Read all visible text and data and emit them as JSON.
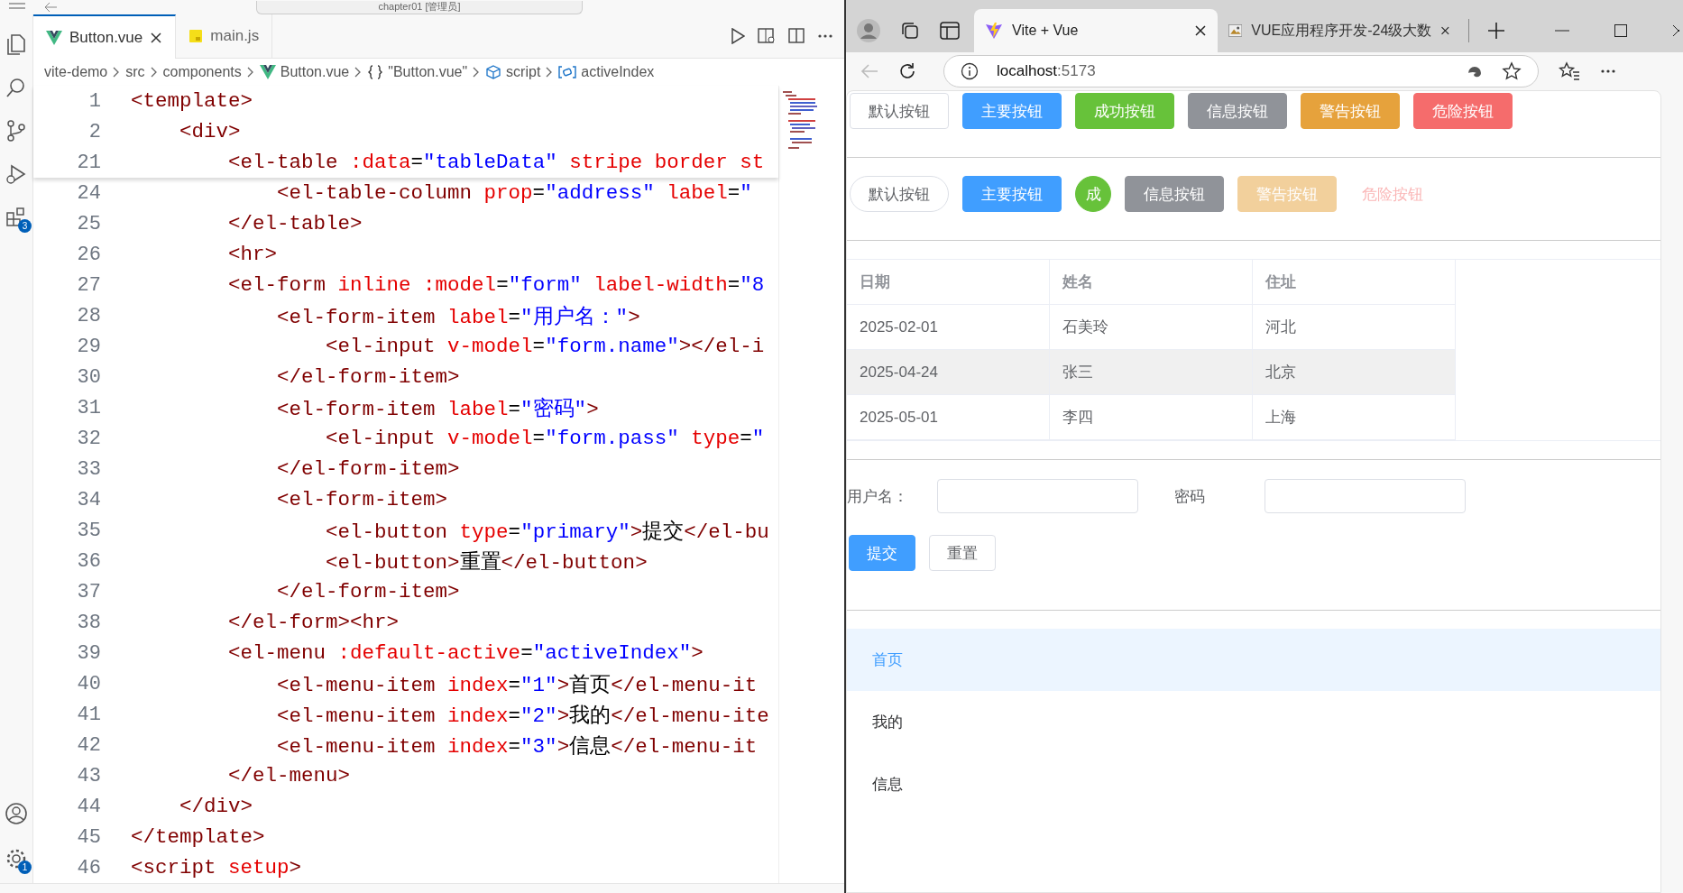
{
  "editor": {
    "title_bar": {
      "search": "chapter01 [管理员]"
    },
    "activity_bar": {
      "extensions_badge": "3",
      "settings_badge": "1"
    },
    "tabs": [
      {
        "label": "Button.vue",
        "kind": "vue",
        "selected": true
      },
      {
        "label": "main.js",
        "kind": "js",
        "selected": false
      }
    ],
    "breadcrumb": [
      {
        "label": "vite-demo",
        "kind": "folder"
      },
      {
        "label": "src",
        "kind": "folder"
      },
      {
        "label": "components",
        "kind": "folder"
      },
      {
        "label": "Button.vue",
        "kind": "vue"
      },
      {
        "label": "\"Button.vue\"",
        "kind": "braces"
      },
      {
        "label": "script",
        "kind": "cube"
      },
      {
        "label": "activeIndex",
        "kind": "field"
      }
    ],
    "sticky_lines": [
      {
        "number": "1",
        "code": "<template>"
      },
      {
        "number": "2",
        "code": "    <div>"
      },
      {
        "number": "21",
        "code": "        <el-table :data=\"tableData\" stripe border st"
      }
    ],
    "lines": [
      {
        "number": "24",
        "code": "            <el-table-column prop=\"address\" label=\""
      },
      {
        "number": "25",
        "code": "        </el-table>"
      },
      {
        "number": "26",
        "code": "        <hr>"
      },
      {
        "number": "27",
        "code": "        <el-form inline :model=\"form\" label-width=\"8"
      },
      {
        "number": "28",
        "code": "            <el-form-item label=\"用户名：\">"
      },
      {
        "number": "29",
        "code": "                <el-input v-model=\"form.name\"></el-i"
      },
      {
        "number": "30",
        "code": "            </el-form-item>"
      },
      {
        "number": "31",
        "code": "            <el-form-item label=\"密码\">"
      },
      {
        "number": "32",
        "code": "                <el-input v-model=\"form.pass\" type=\""
      },
      {
        "number": "33",
        "code": "            </el-form-item>"
      },
      {
        "number": "34",
        "code": "            <el-form-item>"
      },
      {
        "number": "35",
        "code": "                <el-button type=\"primary\">提交</el-bu"
      },
      {
        "number": "36",
        "code": "                <el-button>重置</el-button>"
      },
      {
        "number": "37",
        "code": "            </el-form-item>"
      },
      {
        "number": "38",
        "code": "        </el-form><hr>"
      },
      {
        "number": "39",
        "code": "        <el-menu :default-active=\"activeIndex\">"
      },
      {
        "number": "40",
        "code": "            <el-menu-item index=\"1\">首页</el-menu-it"
      },
      {
        "number": "41",
        "code": "            <el-menu-item index=\"2\">我的</el-menu-ite"
      },
      {
        "number": "42",
        "code": "            <el-menu-item index=\"3\">信息</el-menu-it"
      },
      {
        "number": "43",
        "code": "        </el-menu>"
      },
      {
        "number": "44",
        "code": "    </div>"
      },
      {
        "number": "45",
        "code": "</template>"
      },
      {
        "number": "46",
        "code": "<script setup>"
      }
    ]
  },
  "browser": {
    "tabs": [
      {
        "label": "Vite + Vue",
        "kind": "vite",
        "selected": true
      },
      {
        "label": "VUE应用程序开发-24级大数",
        "kind": "image",
        "selected": false
      }
    ],
    "address": {
      "host": "localhost",
      "port": ":5173"
    },
    "page": {
      "button_rows": [
        [
          {
            "label": "默认按钮",
            "kind": "default",
            "round": false,
            "circle": false,
            "link": false,
            "disabled": false
          },
          {
            "label": "主要按钮",
            "kind": "primary",
            "round": false,
            "circle": false,
            "link": false,
            "disabled": false
          },
          {
            "label": "成功按钮",
            "kind": "success",
            "round": false,
            "circle": false,
            "link": false,
            "disabled": false
          },
          {
            "label": "信息按钮",
            "kind": "info",
            "round": false,
            "circle": false,
            "link": false,
            "disabled": false
          },
          {
            "label": "警告按钮",
            "kind": "warning",
            "round": false,
            "circle": false,
            "link": false,
            "disabled": false
          },
          {
            "label": "危险按钮",
            "kind": "danger",
            "round": false,
            "circle": false,
            "link": false,
            "disabled": false
          }
        ],
        [
          {
            "label": "默认按钮",
            "kind": "default",
            "round": true,
            "circle": false,
            "link": false,
            "disabled": false
          },
          {
            "label": "主要按钮",
            "kind": "primary",
            "round": false,
            "circle": false,
            "link": false,
            "disabled": false
          },
          {
            "label": "成",
            "kind": "success",
            "round": false,
            "circle": true,
            "link": false,
            "disabled": false
          },
          {
            "label": "信息按钮",
            "kind": "info",
            "round": false,
            "circle": false,
            "link": false,
            "disabled": false
          },
          {
            "label": "警告按钮",
            "kind": "warning",
            "round": false,
            "circle": false,
            "link": false,
            "disabled": true
          },
          {
            "label": "危险按钮",
            "kind": "danger",
            "round": false,
            "circle": false,
            "link": true,
            "disabled": true
          }
        ]
      ],
      "table": {
        "striped": true,
        "columns": [
          "日期",
          "姓名",
          "住址"
        ],
        "rows": [
          [
            "2025-02-01",
            "石美玲",
            "河北"
          ],
          [
            "2025-04-24",
            "张三",
            "北京"
          ],
          [
            "2025-05-01",
            "李四",
            "上海"
          ]
        ]
      },
      "form": {
        "fields": [
          {
            "label": "用户名："
          },
          {
            "label": "密码"
          }
        ],
        "buttons": [
          {
            "label": "提交",
            "kind": "primary"
          },
          {
            "label": "重置",
            "kind": "default"
          }
        ]
      },
      "menu": [
        {
          "label": "首页",
          "selected": true
        },
        {
          "label": "我的",
          "selected": false
        },
        {
          "label": "信息",
          "selected": false
        }
      ]
    }
  }
}
